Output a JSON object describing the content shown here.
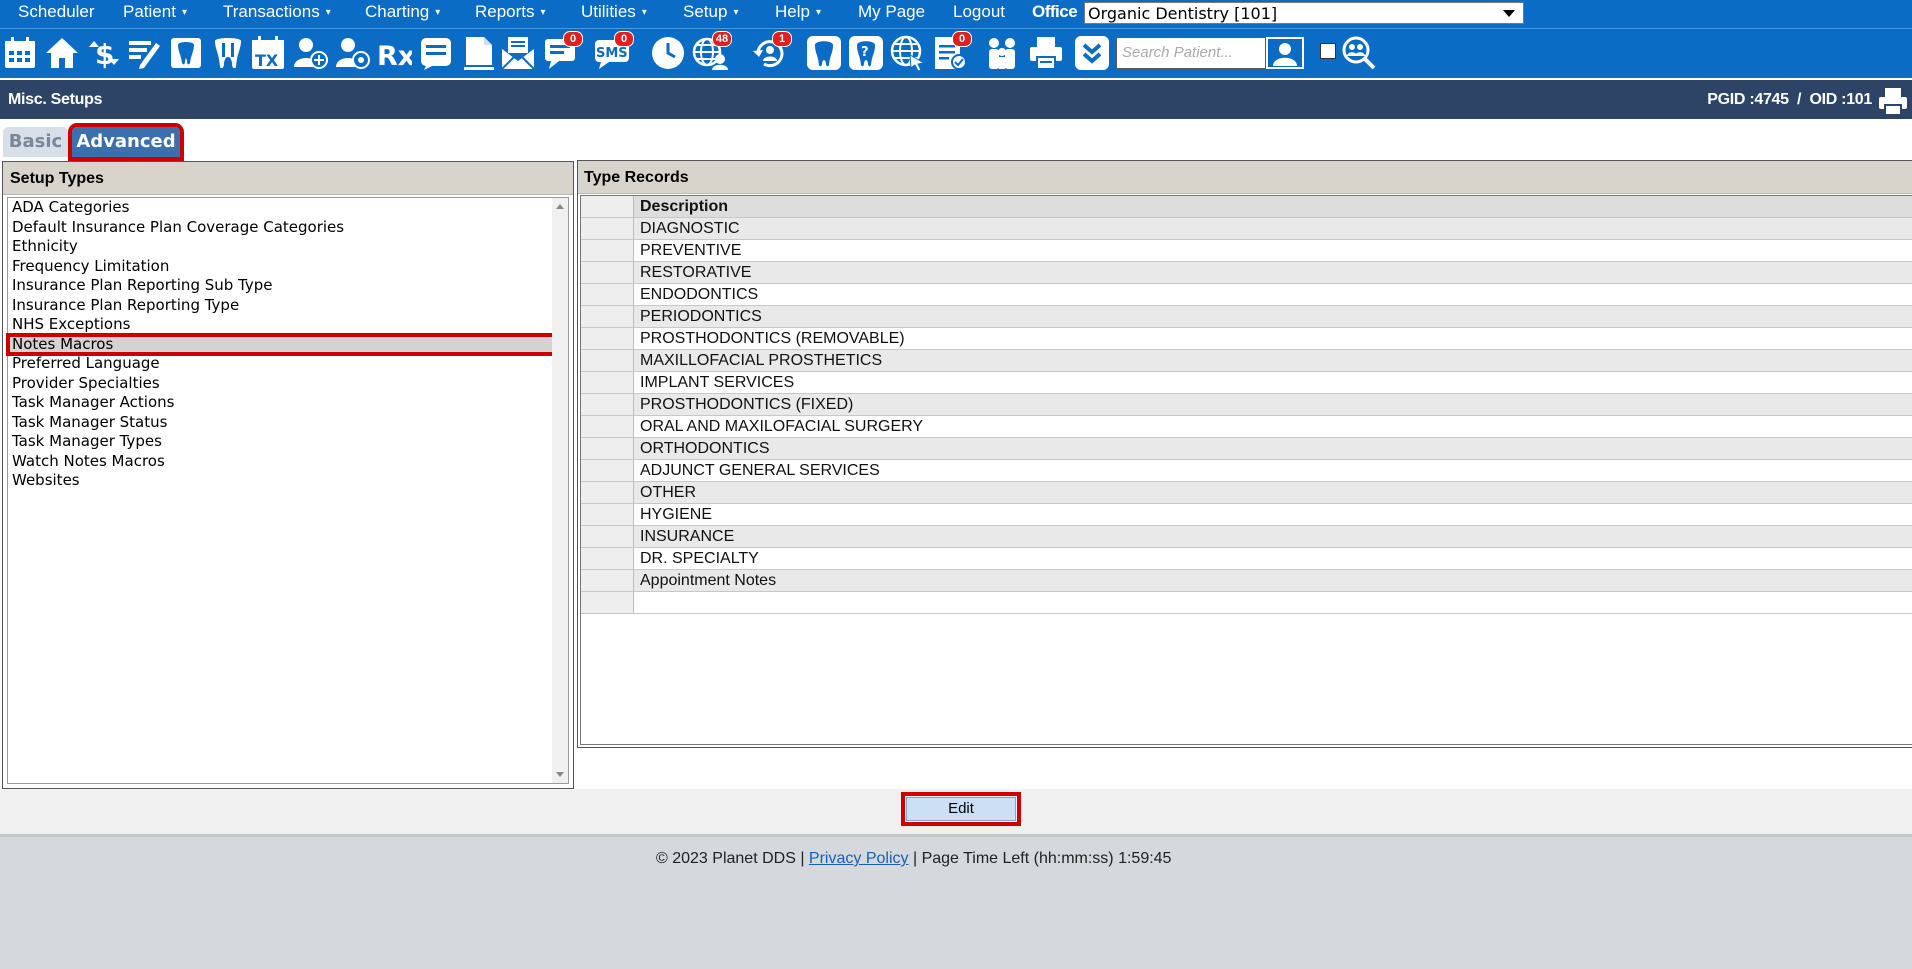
{
  "menu": {
    "items": [
      {
        "label": "Scheduler",
        "has_caret": false
      },
      {
        "label": "Patient",
        "has_caret": true
      },
      {
        "label": "Transactions",
        "has_caret": true
      },
      {
        "label": "Charting",
        "has_caret": true
      },
      {
        "label": "Reports",
        "has_caret": true
      },
      {
        "label": "Utilities",
        "has_caret": true
      },
      {
        "label": "Setup",
        "has_caret": true
      },
      {
        "label": "Help",
        "has_caret": true
      },
      {
        "label": "My Page",
        "has_caret": false
      },
      {
        "label": "Logout",
        "has_caret": false
      }
    ],
    "caret": "▾",
    "office_label": "Office",
    "office_value": "Organic Dentistry [101]"
  },
  "toolbar": {
    "icons": [
      {
        "name": "calendar-icon"
      },
      {
        "name": "home-icon"
      },
      {
        "name": "billing-icon"
      },
      {
        "name": "edit-notes-icon"
      },
      {
        "name": "tooth-chart-icon"
      },
      {
        "name": "perio-chart-icon"
      },
      {
        "name": "treatment-plan-icon",
        "text": "TX"
      },
      {
        "name": "add-patient-icon"
      },
      {
        "name": "patient-manage-icon"
      },
      {
        "name": "prescription-icon",
        "text": "Rx"
      },
      {
        "name": "notes-icon"
      },
      {
        "name": "document-icon"
      },
      {
        "name": "email-icon"
      },
      {
        "name": "chat-icon",
        "badge": "0"
      },
      {
        "name": "sms-icon",
        "text": "SMS",
        "badge": "0"
      },
      {
        "name": "clock-icon"
      },
      {
        "name": "web-patients-icon",
        "badge": "48"
      },
      {
        "name": "recall-icon",
        "badge": "1"
      },
      {
        "name": "tooth-icon"
      },
      {
        "name": "help-tooth-icon"
      },
      {
        "name": "globe-settings-icon"
      },
      {
        "name": "claims-icon",
        "badge": "0"
      },
      {
        "name": "family-icon"
      },
      {
        "name": "print-icon"
      },
      {
        "name": "expand-icon"
      }
    ],
    "search_placeholder": "Search Patient..."
  },
  "titlebar": {
    "title": "Misc. Setups",
    "pgid": "PGID :4745  /  OID :101"
  },
  "tabs": {
    "basic": "Basic",
    "advanced": "Advanced"
  },
  "setup_types": {
    "heading": "Setup Types",
    "items": [
      "ADA Categories",
      "Default Insurance Plan Coverage Categories",
      "Ethnicity",
      "Frequency Limitation",
      "Insurance Plan Reporting Sub Type",
      "Insurance Plan Reporting Type",
      "NHS Exceptions",
      "Notes Macros",
      "Preferred Language",
      "Provider Specialties",
      "Task Manager Actions",
      "Task Manager Status",
      "Task Manager Types",
      "Watch Notes Macros",
      "Websites"
    ],
    "selected": "Notes Macros"
  },
  "type_records": {
    "heading": "Type Records",
    "column": "Description",
    "rows": [
      "DIAGNOSTIC",
      "PREVENTIVE",
      "RESTORATIVE",
      "ENDODONTICS",
      "PERIODONTICS",
      "PROSTHODONTICS (REMOVABLE)",
      "MAXILLOFACIAL PROSTHETICS",
      "IMPLANT SERVICES",
      "PROSTHODONTICS (FIXED)",
      "ORAL AND MAXILOFACIAL SURGERY",
      "ORTHODONTICS",
      "ADJUNCT GENERAL SERVICES",
      "OTHER",
      "HYGIENE",
      "INSURANCE",
      "DR. SPECIALTY",
      "Appointment Notes",
      ""
    ]
  },
  "actions": {
    "edit": "Edit"
  },
  "footer": {
    "copyright": "© 2023 Planet DDS |",
    "privacy": "Privacy Policy",
    "separator": "|",
    "time_left": "Page Time Left (hh:mm:ss) 1:59:45"
  },
  "colors": {
    "brand_blue": "#0a6cc4",
    "title_navy": "#2e4467",
    "highlight_red": "#cc0000"
  }
}
